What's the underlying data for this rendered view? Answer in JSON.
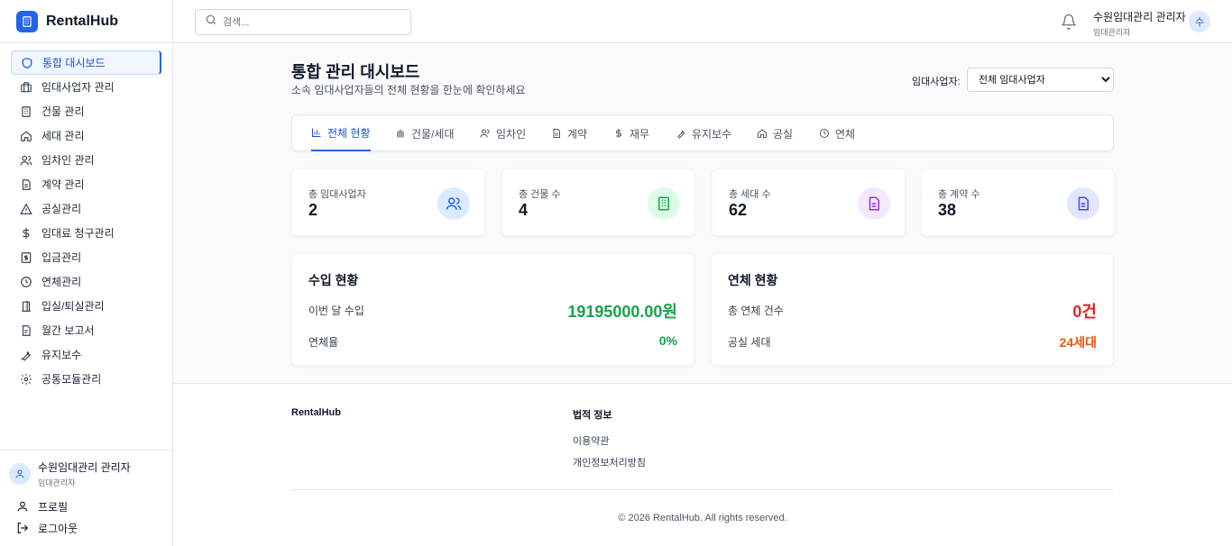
{
  "app": {
    "name": "RentalHub"
  },
  "sidebar": {
    "items": [
      {
        "label": "통합 대시보드",
        "icon": "shield-icon",
        "active": true
      },
      {
        "label": "임대사업자 관리",
        "icon": "briefcase-icon"
      },
      {
        "label": "건물 관리",
        "icon": "building-icon"
      },
      {
        "label": "세대 관리",
        "icon": "home-icon"
      },
      {
        "label": "임차인 관리",
        "icon": "users-icon"
      },
      {
        "label": "계약 관리",
        "icon": "document-icon"
      },
      {
        "label": "공실관리",
        "icon": "warning-icon"
      },
      {
        "label": "임대료 청구관리",
        "icon": "dollar-icon"
      },
      {
        "label": "입금관리",
        "icon": "receipt-icon"
      },
      {
        "label": "연체관리",
        "icon": "clock-icon"
      },
      {
        "label": "입실/퇴실관리",
        "icon": "door-icon"
      },
      {
        "label": "월간 보고서",
        "icon": "report-icon"
      },
      {
        "label": "유지보수",
        "icon": "wrench-icon"
      },
      {
        "label": "공통모듈관리",
        "icon": "gear-icon"
      }
    ],
    "user": {
      "name": "수원임대관리 관리자",
      "role": "임대관리자"
    },
    "profile_label": "프로필",
    "logout_label": "로그아웃"
  },
  "topbar": {
    "search_placeholder": "검색...",
    "user": {
      "name": "수원임대관리 관리자",
      "role": "임대관리자",
      "initial": "수"
    }
  },
  "page": {
    "title": "통합 관리 대시보드",
    "subtitle": "소속 임대사업자들의 전체 현황을 한눈에 확인하세요",
    "filter_label": "임대사업자:",
    "filter_value": "전체 임대사업자"
  },
  "tabs": [
    {
      "label": "전체 현황",
      "icon": "bar-chart-icon",
      "active": true
    },
    {
      "label": "건물/세대",
      "icon": "building-icon"
    },
    {
      "label": "임차인",
      "icon": "users-icon"
    },
    {
      "label": "계약",
      "icon": "document-icon"
    },
    {
      "label": "재무",
      "icon": "dollar-icon"
    },
    {
      "label": "유지보수",
      "icon": "wrench-icon"
    },
    {
      "label": "공실",
      "icon": "home-icon"
    },
    {
      "label": "연체",
      "icon": "clock-icon"
    }
  ],
  "stats": [
    {
      "label": "총 임대사업자",
      "value": "2",
      "icon": "users-icon",
      "color": "#2563eb",
      "bg": "#dbeafe"
    },
    {
      "label": "총 건물 수",
      "value": "4",
      "icon": "building-icon",
      "color": "#16a34a",
      "bg": "#dcfce7"
    },
    {
      "label": "총 세대 수",
      "value": "62",
      "icon": "document-icon",
      "color": "#9333ea",
      "bg": "#f3e8ff"
    },
    {
      "label": "총 계약 수",
      "value": "38",
      "icon": "document-icon",
      "color": "#4f46e5",
      "bg": "#e0e7ff"
    }
  ],
  "income": {
    "title": "수입 현황",
    "rows": [
      {
        "label": "이번 달 수입",
        "value": "19195000.00원",
        "color": "#16a34a"
      },
      {
        "label": "연체율",
        "value": "0%",
        "color": "#16a34a"
      }
    ]
  },
  "overdue": {
    "title": "연체 현황",
    "rows": [
      {
        "label": "총 연체 건수",
        "value": "0건",
        "color": "#dc2626"
      },
      {
        "label": "공실 세대",
        "value": "24세대",
        "color": "#ea580c"
      }
    ]
  },
  "footer": {
    "brand": "RentalHub",
    "legal_title": "법적 정보",
    "terms": "이용약관",
    "privacy": "개인정보처리방침",
    "copyright": "© 2026 RentalHub. All rights reserved."
  }
}
